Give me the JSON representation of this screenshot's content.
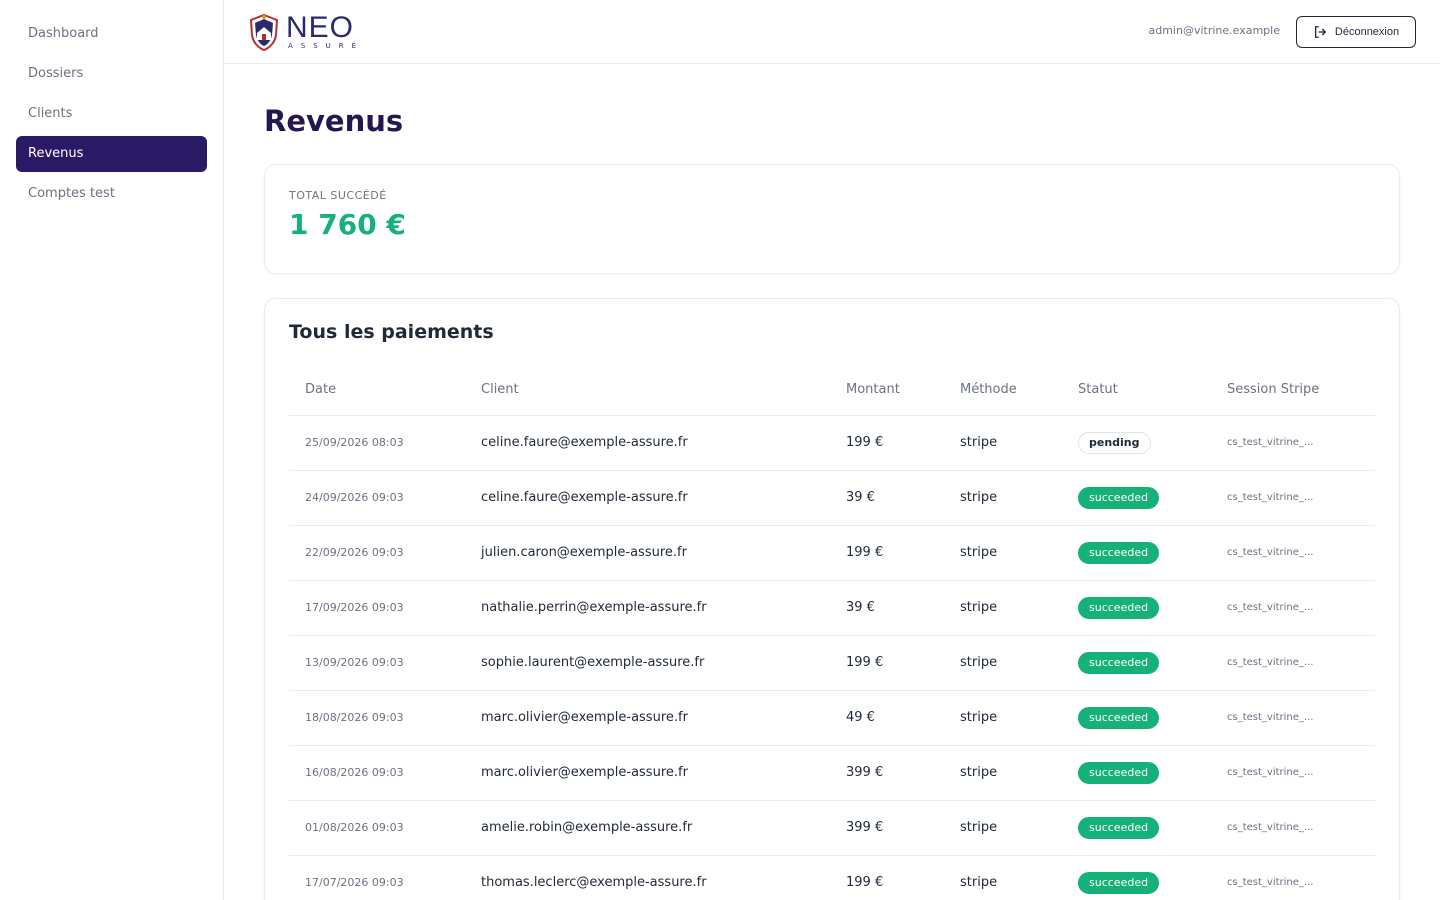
{
  "sidebar": {
    "items": [
      {
        "label": "Dashboard",
        "active": false
      },
      {
        "label": "Dossiers",
        "active": false
      },
      {
        "label": "Clients",
        "active": false
      },
      {
        "label": "Revenus",
        "active": true
      },
      {
        "label": "Comptes test",
        "active": false
      }
    ]
  },
  "header": {
    "logo_text": "NEO",
    "logo_sub": "ASSURÉ",
    "user_email": "admin@vitrine.example",
    "logout_label": "Déconnexion"
  },
  "main": {
    "title": "Revenus",
    "total": {
      "label": "TOTAL SUCCÉDÉ",
      "value": "1 760 €"
    },
    "payments": {
      "title": "Tous les paiements",
      "columns": [
        "Date",
        "Client",
        "Montant",
        "Méthode",
        "Statut",
        "Session Stripe"
      ],
      "rows": [
        {
          "date": "25/09/2026 08:03",
          "client": "celine.faure@exemple-assure.fr",
          "amount": "199 €",
          "method": "stripe",
          "status": "pending",
          "session": "cs_test_vitrine_..."
        },
        {
          "date": "24/09/2026 09:03",
          "client": "celine.faure@exemple-assure.fr",
          "amount": "39 €",
          "method": "stripe",
          "status": "succeeded",
          "session": "cs_test_vitrine_..."
        },
        {
          "date": "22/09/2026 09:03",
          "client": "julien.caron@exemple-assure.fr",
          "amount": "199 €",
          "method": "stripe",
          "status": "succeeded",
          "session": "cs_test_vitrine_..."
        },
        {
          "date": "17/09/2026 09:03",
          "client": "nathalie.perrin@exemple-assure.fr",
          "amount": "39 €",
          "method": "stripe",
          "status": "succeeded",
          "session": "cs_test_vitrine_..."
        },
        {
          "date": "13/09/2026 09:03",
          "client": "sophie.laurent@exemple-assure.fr",
          "amount": "199 €",
          "method": "stripe",
          "status": "succeeded",
          "session": "cs_test_vitrine_..."
        },
        {
          "date": "18/08/2026 09:03",
          "client": "marc.olivier@exemple-assure.fr",
          "amount": "49 €",
          "method": "stripe",
          "status": "succeeded",
          "session": "cs_test_vitrine_..."
        },
        {
          "date": "16/08/2026 09:03",
          "client": "marc.olivier@exemple-assure.fr",
          "amount": "399 €",
          "method": "stripe",
          "status": "succeeded",
          "session": "cs_test_vitrine_..."
        },
        {
          "date": "01/08/2026 09:03",
          "client": "amelie.robin@exemple-assure.fr",
          "amount": "399 €",
          "method": "stripe",
          "status": "succeeded",
          "session": "cs_test_vitrine_..."
        },
        {
          "date": "17/07/2026 09:03",
          "client": "thomas.leclerc@exemple-assure.fr",
          "amount": "199 €",
          "method": "stripe",
          "status": "succeeded",
          "session": "cs_test_vitrine_..."
        }
      ]
    }
  },
  "colors": {
    "brand": "#2a1a66",
    "success": "#16b178",
    "title": "#24174f"
  },
  "icons": {
    "logout": "logout-icon",
    "logo": "shield-logo-icon"
  }
}
